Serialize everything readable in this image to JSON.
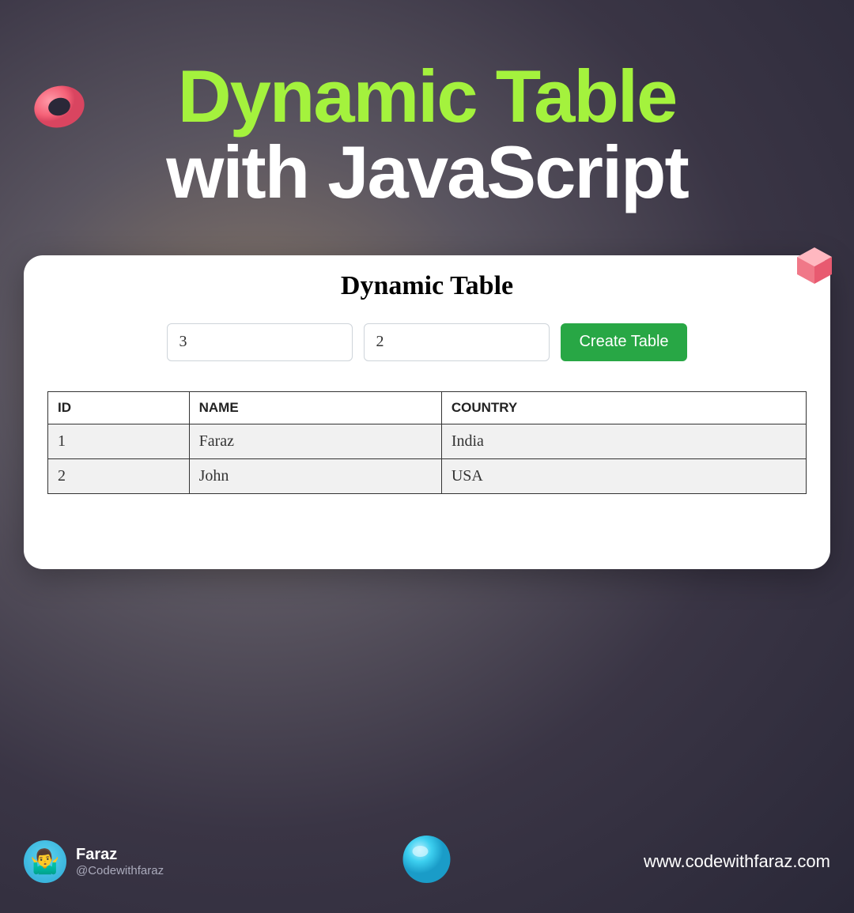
{
  "title": {
    "line1": "Dynamic Table",
    "line2": "with JavaScript"
  },
  "card": {
    "heading": "Dynamic Table",
    "input1_value": "3",
    "input2_value": "2",
    "button_label": "Create Table",
    "table": {
      "headers": [
        "ID",
        "NAME",
        "COUNTRY"
      ],
      "rows": [
        [
          "1",
          "Faraz",
          "India"
        ],
        [
          "2",
          "John",
          "USA"
        ]
      ]
    }
  },
  "author": {
    "name": "Faraz",
    "handle": "@Codewithfaraz",
    "avatar_emoji": "🤷‍♂️"
  },
  "website": "www.codewithfaraz.com",
  "decorations": {
    "torus": "torus-icon",
    "cube": "cube-icon",
    "sphere": "sphere-icon"
  }
}
